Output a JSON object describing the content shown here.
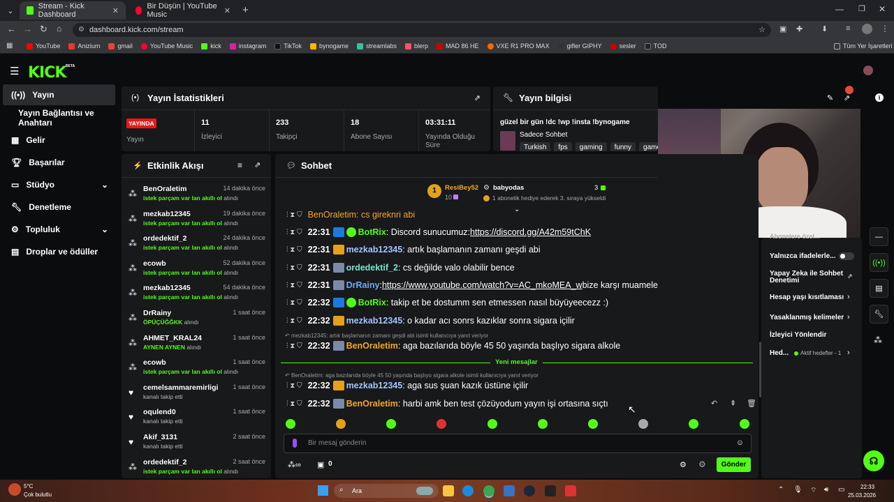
{
  "browser": {
    "tabs": [
      {
        "title": "Stream - Kick Dashboard"
      },
      {
        "title": "Bir Düşün | YouTube Music"
      }
    ],
    "url": "dashboard.kick.com/stream",
    "bookmarks": [
      "YouTube",
      "Anizium",
      "gmail",
      "YouTube Music",
      "kick",
      "instagram",
      "TikTok",
      "bynogame",
      "streamlabs",
      "blerp",
      "MAD 86 HE",
      "VXE R1 PRO MAX",
      "gifler GIPHY",
      "sesler",
      "TOD"
    ],
    "all_bookmarks": "Tüm Yer İşaretleri"
  },
  "kick": {
    "logo": "KICK",
    "nav": [
      {
        "label": "Yayın"
      },
      {
        "label": "Yayın Bağlantısı ve Anahtarı"
      },
      {
        "label": "Gelir"
      },
      {
        "label": "Başarılar"
      },
      {
        "label": "Stüdyo"
      },
      {
        "label": "Denetleme"
      },
      {
        "label": "Topluluk"
      },
      {
        "label": "Droplar ve ödüller"
      }
    ],
    "stats": {
      "title": "Yayın İstatistikleri",
      "live_badge": "YAYINDA",
      "live_label": "Yayın",
      "items": [
        {
          "value": "11",
          "label": "İzleyici"
        },
        {
          "value": "233",
          "label": "Takipçi"
        },
        {
          "value": "18",
          "label": "Abone Sayısı"
        },
        {
          "value": "03:31:11",
          "label": "Yayında Olduğu Süre"
        }
      ]
    },
    "info": {
      "title": "Yayın bilgisi",
      "stream_title": "güzel bir gün !dc !wp !insta !bynogame",
      "category": "Sadece Sohbet",
      "tags": [
        "Turkish",
        "fps",
        "gaming",
        "funny",
        "game"
      ]
    },
    "activity": {
      "title": "Etkinlik Akışı",
      "items": [
        {
          "name": "BenOraletim",
          "time": "14 dakika önce",
          "highlight": "istek parçam var lan akıllı ol",
          "suffix": "alındı",
          "icon": "redeem-icon"
        },
        {
          "name": "mezkab12345",
          "time": "19 dakika önce",
          "highlight": "istek parçam var lan akıllı ol",
          "suffix": "alındı",
          "icon": "redeem-icon"
        },
        {
          "name": "ordedektif_2",
          "time": "24 dakika önce",
          "highlight": "istek parçam var lan akıllı ol",
          "suffix": "alındı",
          "icon": "redeem-icon"
        },
        {
          "name": "ecowb",
          "time": "52 dakika önce",
          "highlight": "istek parçam var lan akıllı ol",
          "suffix": "alındı",
          "icon": "redeem-icon"
        },
        {
          "name": "mezkab12345",
          "time": "54 dakika önce",
          "highlight": "istek parçam var lan akıllı ol",
          "suffix": "alındı",
          "icon": "redeem-icon"
        },
        {
          "name": "DrRainy",
          "time": "1 saat önce",
          "highlight": "ÖPÜÇÜĞĞKK",
          "suffix": "alındı",
          "icon": "redeem-icon"
        },
        {
          "name": "AHMET_KRAL24",
          "time": "1 saat önce",
          "highlight": "AYNEN AYNEN",
          "suffix": "alındı",
          "icon": "redeem-icon"
        },
        {
          "name": "ecowb",
          "time": "1 saat önce",
          "highlight": "istek parçam var lan akıllı ol",
          "suffix": "alındı",
          "icon": "redeem-icon"
        },
        {
          "name": "cemelsammaremirligi",
          "time": "1 saat önce",
          "highlight": "",
          "suffix": "kanalı takip etti",
          "icon": "heart-icon"
        },
        {
          "name": "oqulend0",
          "time": "1 saat önce",
          "highlight": "",
          "suffix": "kanalı takip etti",
          "icon": "heart-icon"
        },
        {
          "name": "Akif_3131",
          "time": "2 saat önce",
          "highlight": "",
          "suffix": "kanalı takip etti",
          "icon": "heart-icon"
        },
        {
          "name": "ordedektif_2",
          "time": "2 saat önce",
          "highlight": "istek parçam var lan akıllı ol",
          "suffix": "alındı",
          "icon": "redeem-icon"
        }
      ]
    },
    "chat": {
      "title": "Sohbet",
      "pinned_user": "ResiBey52",
      "pinned_count": "10",
      "pinned_rank": "1",
      "gifter": "babyodas",
      "gifter_count": "3",
      "gift_text": "1 abonelik hediye ederek 3. sıraya yükseldi",
      "partial_top": "BenOraletim: cs gireknri abi",
      "messages": [
        {
          "time": "22:31",
          "user": "BotRix",
          "color": "#53fc18",
          "text": ": Discord sunucumuz: ",
          "link": "https://discord.gg/A42m59tChK",
          "after": ""
        },
        {
          "time": "22:31",
          "user": "mezkab12345",
          "color": "#a0c4ff",
          "text": ": artık başlamanın zamanı geşdi abi",
          "link": "",
          "after": ""
        },
        {
          "time": "22:31",
          "user": "ordedektif_2",
          "color": "#7fe3d0",
          "text": ": cs değilde valo olabilir bence",
          "link": "",
          "after": ""
        },
        {
          "time": "22:31",
          "user": "DrRainy",
          "color": "#6fa8ff",
          "text": ": ",
          "link": "https://www.youtube.com/watch?v=AC_mkoMEA_w",
          "after": " bize karşı muamele"
        },
        {
          "time": "22:32",
          "user": "BotRix",
          "color": "#53fc18",
          "text": ": takip et be dostumm sen etmessen nasıl büyüyeecezz :)",
          "link": "",
          "after": ""
        },
        {
          "time": "22:32",
          "user": "mezkab12345",
          "color": "#a0c4ff",
          "text": ": o kadar acı sonrs kazıklar sonra sigara içilir",
          "link": "",
          "after": ""
        },
        {
          "time": "22:32",
          "user": "BenOraletim",
          "color": "#f5a623",
          "text": ": aga bazılarıda böyle 45 50 yaşında başlıyo sigara alkole",
          "link": "",
          "after": ""
        },
        {
          "time": "22:32",
          "user": "mezkab12345",
          "color": "#a0c4ff",
          "text": ": aga sus şuan kazık üstüne içilir",
          "link": "",
          "after": ""
        },
        {
          "time": "22:32",
          "user": "BenOraletim",
          "color": "#f5a623",
          "text": ": harbi amk ben test çözüyodum yayın işi ortasına sıçtı",
          "link": "",
          "after": ""
        }
      ],
      "reply1": "mezkab12345: artık başlamanın zamanı geşdi abi isimli kullanıcıya yanıt veriyor",
      "reply2": "BenOraletim: aga bazılarıda böyle 45 50 yaşında başlıyo sigara alkole isimli kullanıcıya yanıt veriyor",
      "new_messages": "Yeni mesajlar",
      "input_placeholder": "Bir mesaj gönderin",
      "points": "0",
      "send": "Gönder"
    },
    "settings": [
      {
        "label": "Abonelere özel..."
      },
      {
        "label": "Yalnızca ifadelerle..."
      },
      {
        "label": "Yapay Zeka ile Sohbet Denetimi"
      },
      {
        "label": "Hesap yaşı kısıtlaması"
      },
      {
        "label": "Yasaklanmış kelimeler"
      },
      {
        "label": "İzleyici Yönlendir"
      },
      {
        "label": "Hed..."
      }
    ],
    "active_goals": "Aktif hedefler - 1"
  },
  "taskbar": {
    "weather_temp": "5°C",
    "weather_desc": "Çok bulutlu",
    "search": "Ara",
    "time": "22:33",
    "date": "25.03.2026"
  }
}
